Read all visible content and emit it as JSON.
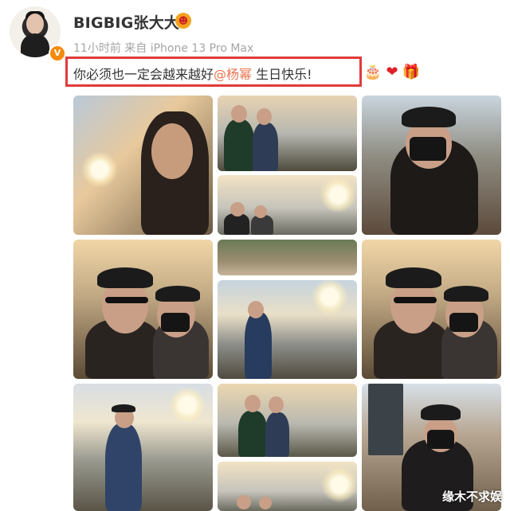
{
  "post": {
    "username": "BIGBIG张大大",
    "meta": "11小时前  来自 iPhone 13 Pro Max",
    "text_before": "你必须也一定会越来越好",
    "mention": "@杨幂",
    "text_after": " 生日快乐!",
    "emojis": [
      "cake-emoji",
      "heart-emoji",
      "gift-emoji"
    ]
  },
  "watermark": "缘木不求娱",
  "colors": {
    "mention": "#eb7350",
    "highlight_box": "#e03a3a",
    "verified": "#f58a0a"
  }
}
